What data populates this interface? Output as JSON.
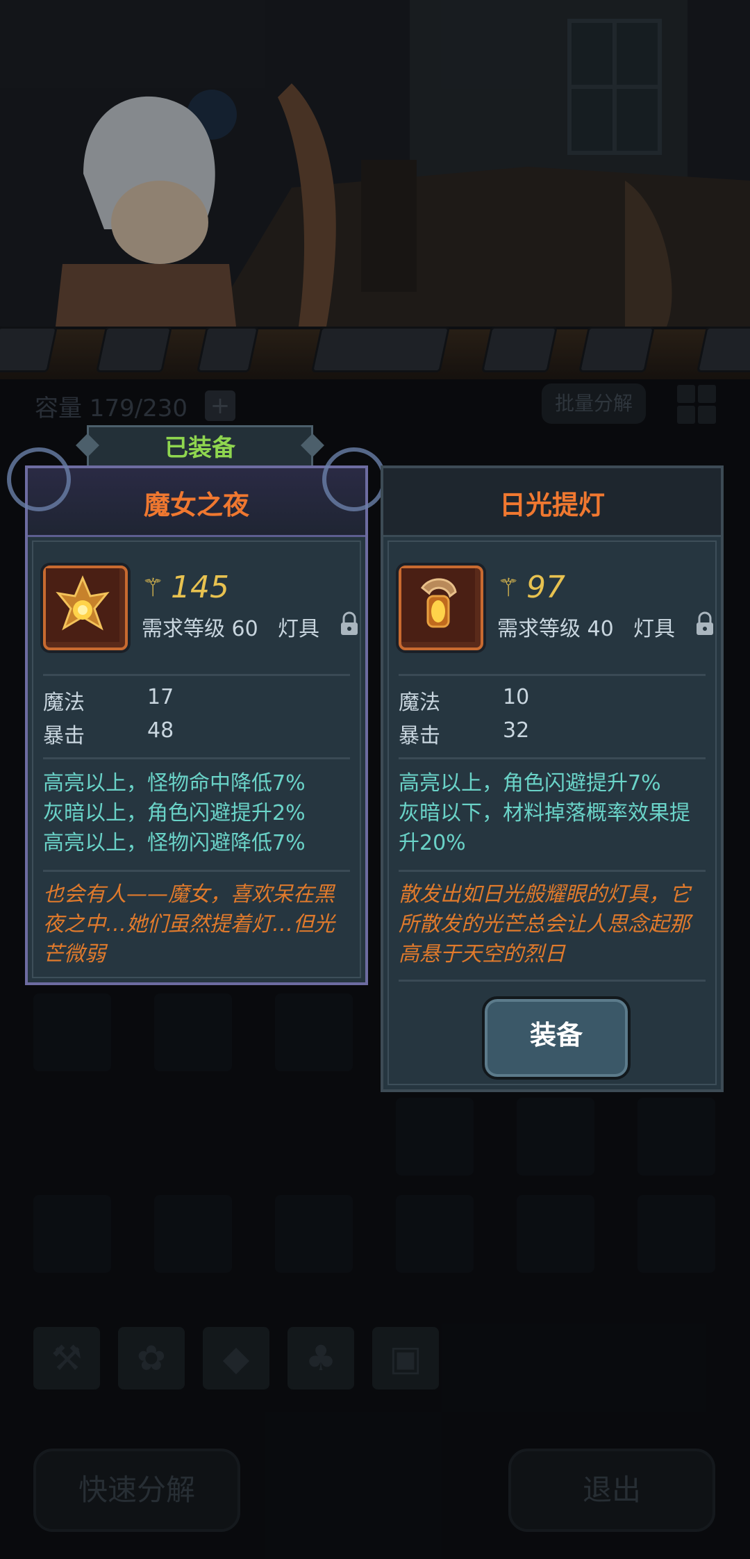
{
  "capacity": {
    "label": "容量 179/230",
    "add_symbol": "+"
  },
  "toolbar": {
    "batch_decompose": "批量分解"
  },
  "equipped_tag": "已装备",
  "items": [
    {
      "name": "魔女之夜",
      "power": "145",
      "required_level": "需求等级 60",
      "type": "灯具",
      "stats": [
        {
          "name": "魔法",
          "value": "17"
        },
        {
          "name": "暴击",
          "value": "48"
        }
      ],
      "effects": [
        "高亮以上，怪物命中降低7%",
        "灰暗以上，角色闪避提升2%",
        "高亮以上，怪物闪避降低7%"
      ],
      "flavor": [
        "也会有人——魔女，喜欢呆在黑",
        "夜之中…她们虽然提着灯…但光",
        "芒微弱"
      ],
      "equipped": true
    },
    {
      "name": "日光提灯",
      "power": "97",
      "required_level": "需求等级 40",
      "type": "灯具",
      "stats": [
        {
          "name": "魔法",
          "value": "10"
        },
        {
          "name": "暴击",
          "value": "32"
        }
      ],
      "effects": [
        "高亮以上，角色闪避提升7%",
        "灰暗以下，材料掉落概率效果提",
        "升20%"
      ],
      "flavor": [
        "散发出如日光般耀眼的灯具，它",
        "所散发的光芒总会让人思念起那",
        "高悬于天空的烈日"
      ],
      "equipped": false,
      "equip_button": "装备"
    }
  ],
  "category_tabs": [
    "weapon-icon",
    "paw-icon",
    "gem-icon",
    "leaf-icon",
    "chest-icon"
  ],
  "bottom": {
    "quick_decompose": "快速分解",
    "exit": "退出"
  },
  "colors": {
    "title_orange": "#f07830",
    "effect_cyan": "#6ad3c8",
    "equipped_green": "#8fd64f",
    "power_gold": "#e8c250"
  }
}
